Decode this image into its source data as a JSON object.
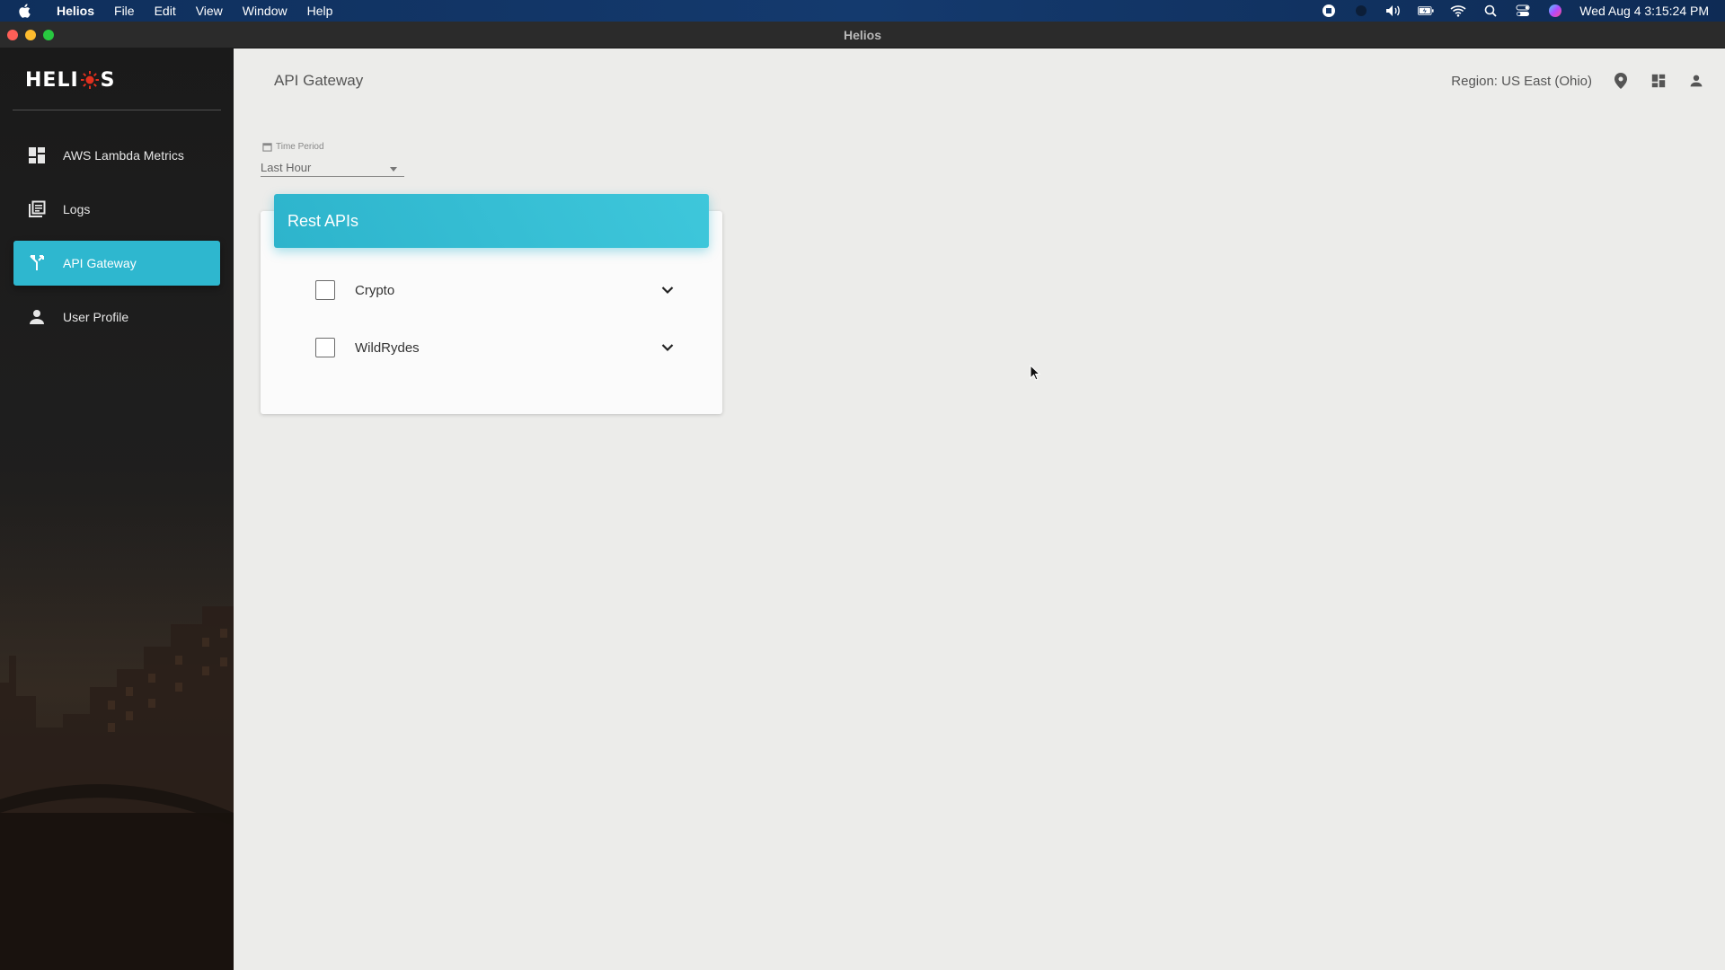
{
  "menubar": {
    "app_name": "Helios",
    "menus": [
      "File",
      "Edit",
      "View",
      "Window",
      "Help"
    ],
    "clock": "Wed Aug 4  3:15:24 PM",
    "status_icons": [
      "screen-record-icon",
      "siri-dot-icon",
      "volume-icon",
      "battery-icon",
      "wifi-icon",
      "spotlight-icon",
      "control-center-icon",
      "siri-icon"
    ]
  },
  "window": {
    "title": "Helios"
  },
  "sidebar": {
    "logo_text_left": "HELI",
    "logo_text_right": "S",
    "items": [
      {
        "label": "AWS Lambda Metrics",
        "icon": "dashboard-icon",
        "active": false
      },
      {
        "label": "Logs",
        "icon": "library-books-icon",
        "active": false
      },
      {
        "label": "API Gateway",
        "icon": "call-split-icon",
        "active": true
      },
      {
        "label": "User Profile",
        "icon": "person-icon",
        "active": false
      }
    ]
  },
  "header": {
    "title": "API Gateway",
    "region": "Region: US East (Ohio)",
    "icons": [
      "location-pin-icon",
      "dashboard-icon",
      "person-icon"
    ]
  },
  "time_period": {
    "label": "Time Period",
    "value": "Last Hour"
  },
  "rest_apis": {
    "title": "Rest APIs",
    "items": [
      {
        "name": "Crypto",
        "checked": false
      },
      {
        "name": "WildRydes",
        "checked": false
      }
    ]
  },
  "colors": {
    "accent": "#2eb7cf",
    "menubar": "#143a6e",
    "main_bg": "#ececea"
  }
}
